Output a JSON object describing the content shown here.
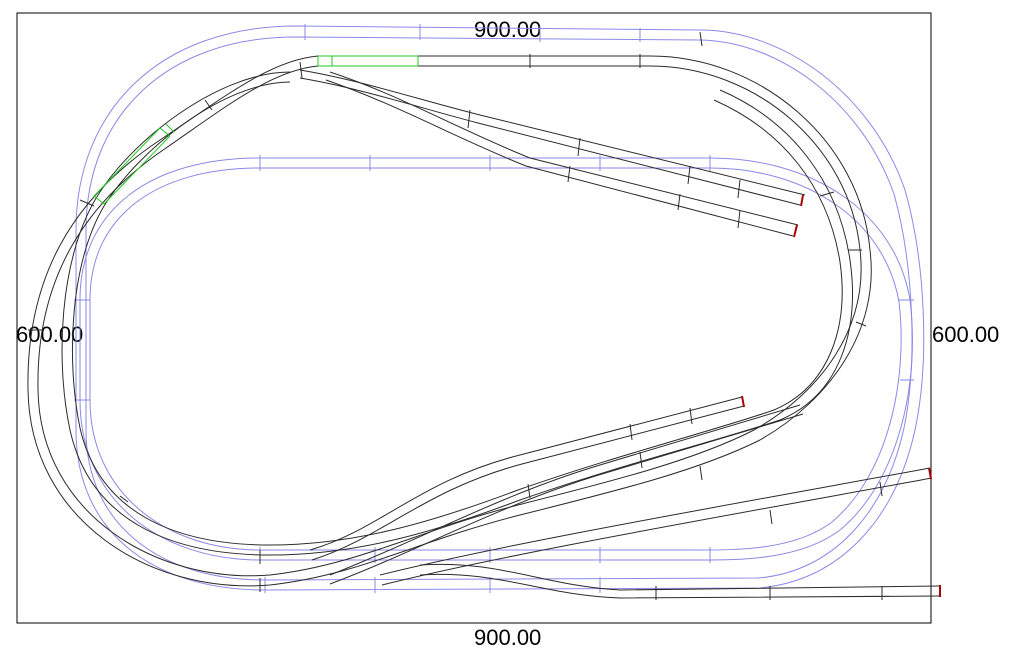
{
  "dimensions": {
    "top": "900.00",
    "bottom": "900.00",
    "left": "600.00",
    "right": "600.00"
  },
  "colors": {
    "background": "#ffffff",
    "board_outline": "#000000",
    "lower_level_track": "#8a8ae6",
    "upper_level_track": "#2b2b2b",
    "selected_track": "#22cc22",
    "track_end_marker": "#aa0000"
  }
}
